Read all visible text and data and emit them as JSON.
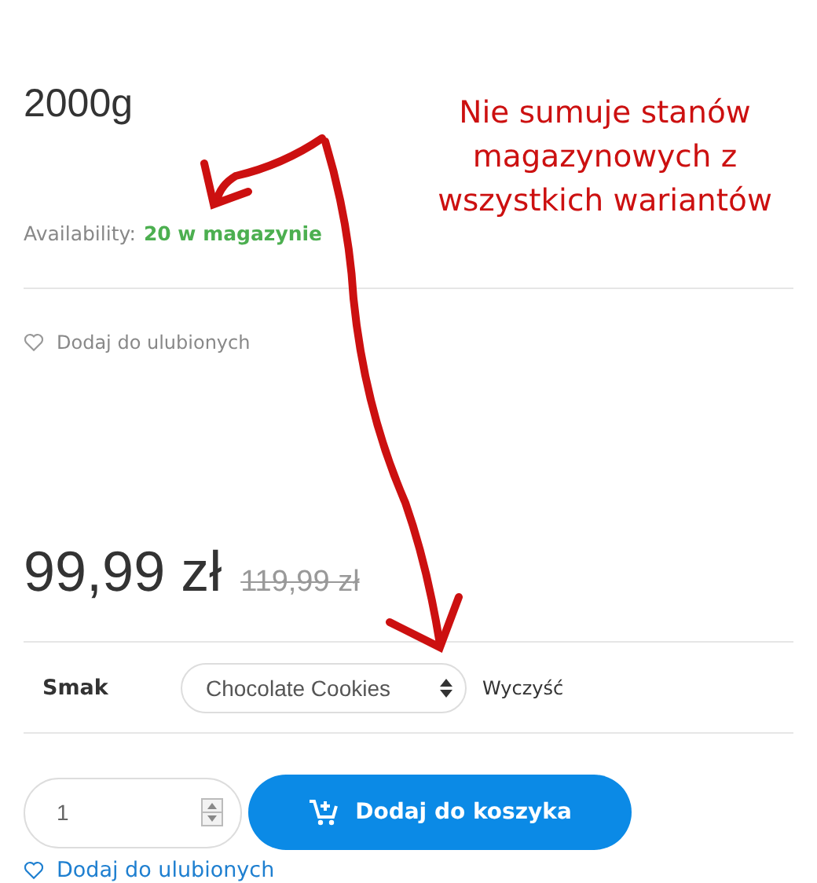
{
  "product": {
    "weight": "2000g",
    "availability_label": "Availability:",
    "availability_value": "20 w magazynie",
    "wishlist_top": "Dodaj do ulubionych",
    "price": "99,99 zł",
    "old_price": "119,99 zł"
  },
  "variant": {
    "label": "Smak",
    "value": "Chocolate Cookies",
    "clear": "Wyczyść"
  },
  "cart": {
    "quantity": "1",
    "button": "Dodaj do koszyka",
    "wishlist": "Dodaj do ulubionych"
  },
  "annotation": {
    "lines": [
      "Nie sumuje stanów",
      "magazynowych z",
      "wszystkich wariantów"
    ]
  }
}
